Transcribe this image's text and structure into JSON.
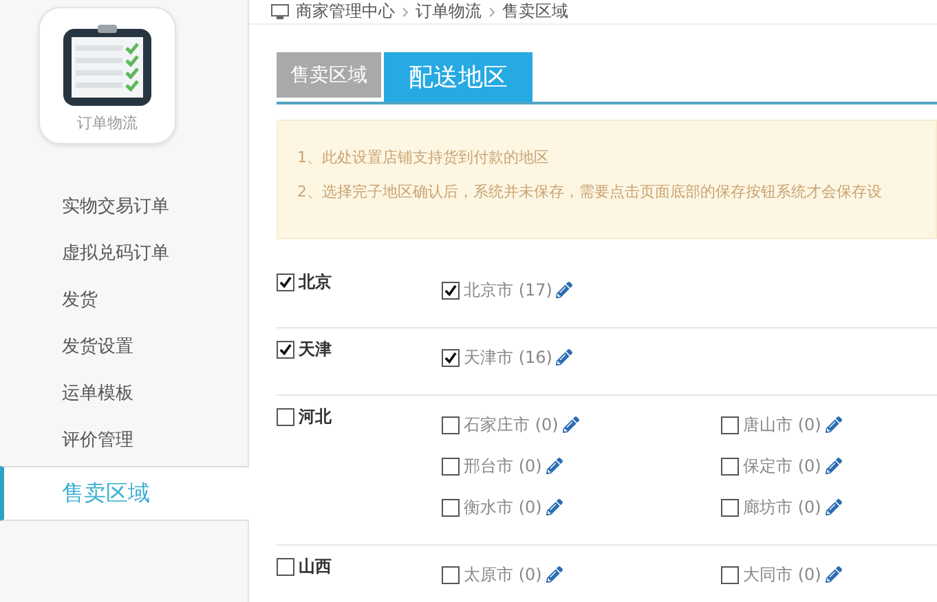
{
  "sidebar": {
    "app": {
      "label": "订单物流"
    },
    "items": [
      {
        "label": "实物交易订单",
        "selected": false
      },
      {
        "label": "虚拟兑码订单",
        "selected": false
      },
      {
        "label": "发货",
        "selected": false
      },
      {
        "label": "发货设置",
        "selected": false
      },
      {
        "label": "运单模板",
        "selected": false
      },
      {
        "label": "评价管理",
        "selected": false
      },
      {
        "label": "售卖区域",
        "selected": true
      }
    ]
  },
  "breadcrumb": [
    "商家管理中心",
    "订单物流",
    "售卖区域"
  ],
  "tabs": [
    {
      "label": "售卖区域",
      "selected": false
    },
    {
      "label": "配送地区",
      "selected": true
    }
  ],
  "notice": [
    "1、此处设置店铺支持货到付款的地区",
    "2、选择完子地区确认后，系统并未保存，需要点击页面底部的保存按钮系统才会保存设"
  ],
  "provinces": [
    {
      "name": "北京",
      "checked": true,
      "cities": [
        {
          "name": "北京市 (17)",
          "checked": true
        }
      ]
    },
    {
      "name": "天津",
      "checked": true,
      "cities": [
        {
          "name": "天津市 (16)",
          "checked": true
        }
      ]
    },
    {
      "name": "河北",
      "checked": false,
      "cities": [
        {
          "name": "石家庄市 (0)",
          "checked": false
        },
        {
          "name": "唐山市 (0)",
          "checked": false
        },
        {
          "name": "邢台市 (0)",
          "checked": false
        },
        {
          "name": "保定市 (0)",
          "checked": false
        },
        {
          "name": "衡水市 (0)",
          "checked": false
        },
        {
          "name": "廊坊市 (0)",
          "checked": false
        }
      ]
    },
    {
      "name": "山西",
      "checked": false,
      "cities": [
        {
          "name": "太原市 (0)",
          "checked": false
        },
        {
          "name": "大同市 (0)",
          "checked": false
        }
      ]
    }
  ]
}
